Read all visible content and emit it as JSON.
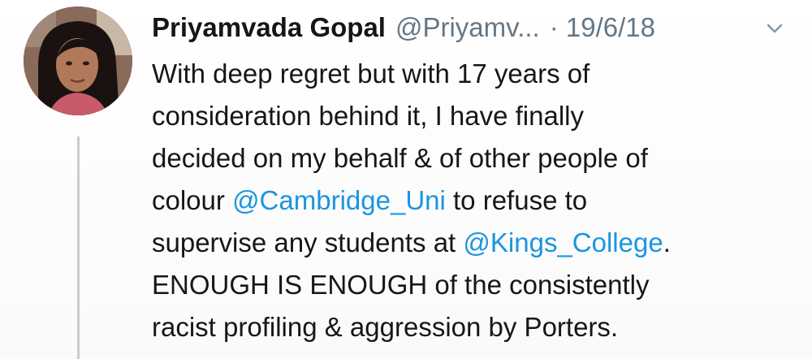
{
  "tweet": {
    "display_name": "Priyamvada Gopal",
    "handle": "@Priyamv...",
    "date": "· 19/6/18",
    "more_icon": "chevron-down-icon",
    "avatar_icon": "profile-photo",
    "lines": [
      {
        "pre": "With deep regret but with 17 years of"
      },
      {
        "pre": "consideration behind it, I have finally"
      },
      {
        "pre": "decided on my behalf & of other people of"
      },
      {
        "pre": "colour ",
        "mention": "@Cambridge_Uni",
        "post": " to refuse to"
      },
      {
        "pre": "supervise any students at ",
        "mention": "@Kings_College",
        "post": "."
      },
      {
        "pre": "ENOUGH IS ENOUGH of the consistently"
      },
      {
        "pre": "racist profiling & aggression by Porters."
      }
    ]
  },
  "colors": {
    "link": "#1b95e0",
    "secondary_text": "#657786",
    "primary_text": "#14171a",
    "thread_line": "#c8ccd0"
  }
}
